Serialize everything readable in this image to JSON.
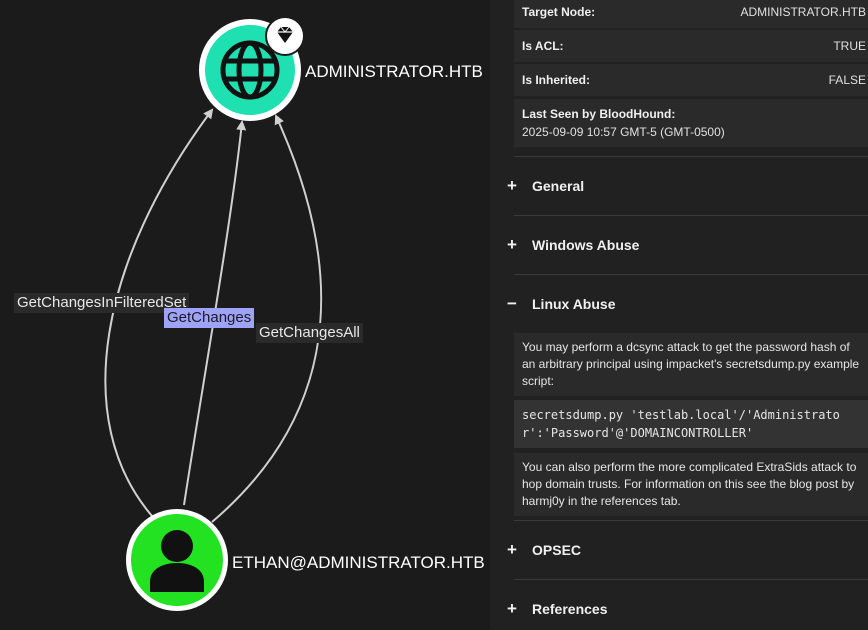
{
  "graph": {
    "target_node": {
      "label": "ADMINISTRATOR.HTB",
      "type": "domain",
      "icon": "globe-icon",
      "badge_icon": "diamond-icon",
      "color": "#1fe0b0"
    },
    "source_node": {
      "label": "ETHAN@ADMINISTRATOR.HTB",
      "type": "user",
      "icon": "user-icon",
      "color": "#22e222"
    },
    "edges": [
      {
        "label": "GetChangesInFilteredSet",
        "selected": false
      },
      {
        "label": "GetChanges",
        "selected": true
      },
      {
        "label": "GetChangesAll",
        "selected": false
      }
    ],
    "colors": {
      "edge": "#d0d0d0",
      "selected_edge_label": "#9ea3f5"
    }
  },
  "panel": {
    "properties": [
      {
        "key": "Target Node:",
        "value": "ADMINISTRATOR.HTB"
      },
      {
        "key": "Is ACL:",
        "value": "TRUE"
      },
      {
        "key": "Is Inherited:",
        "value": "FALSE"
      }
    ],
    "last_seen": {
      "key": "Last Seen by BloodHound:",
      "value": "2025-09-09 10:57 GMT-5 (GMT-0500)"
    },
    "sections": {
      "general": {
        "sign": "+",
        "title": "General"
      },
      "windows_abuse": {
        "sign": "+",
        "title": "Windows Abuse"
      },
      "linux_abuse": {
        "sign": "−",
        "title": "Linux Abuse",
        "intro": "You may perform a dcsync attack to get the password hash of an arbitrary principal using impacket's secretsdump.py example script:",
        "code": "secretsdump.py 'testlab.local'/'Administrator':'Password'@'DOMAINCONTROLLER'",
        "outro": "You can also perform the more complicated ExtraSids attack to hop domain trusts. For information on this see the blog post by harmj0y in the references tab."
      },
      "opsec": {
        "sign": "+",
        "title": "OPSEC"
      },
      "references": {
        "sign": "+",
        "title": "References"
      }
    }
  }
}
